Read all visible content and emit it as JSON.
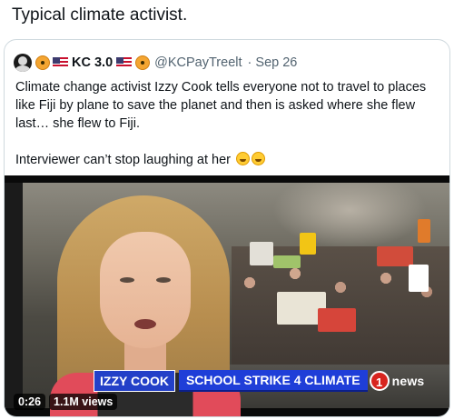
{
  "post": {
    "text": "Typical climate activist."
  },
  "quoted_tweet": {
    "display_name": "KC 3.0",
    "handle": "@KCPayTreelt",
    "date": "Sep 26",
    "body_paragraph_1": "Climate change activist Izzy Cook tells everyone not to travel to places like Fiji by plane to save the planet and then is asked where she flew last… she flew to Fiji.",
    "body_paragraph_2": "Interviewer can’t stop laughing at her",
    "emojis": [
      "radioactive-emoji",
      "us-flag-emoji",
      "rolling-laughing-emoji"
    ]
  },
  "video": {
    "lower_third_name": "IZZY COOK",
    "lower_third_topic": "SCHOOL STRIKE 4 CLIMATE",
    "channel_logo_number": "1",
    "channel_logo_text": "news",
    "duration": "0:26",
    "views": "1.1M views"
  },
  "colors": {
    "text_primary": "#0f1419",
    "text_secondary": "#536471",
    "card_border": "#cfd9de",
    "lower_third_blue": "#1f3ed8",
    "channel_red": "#d8241e"
  }
}
